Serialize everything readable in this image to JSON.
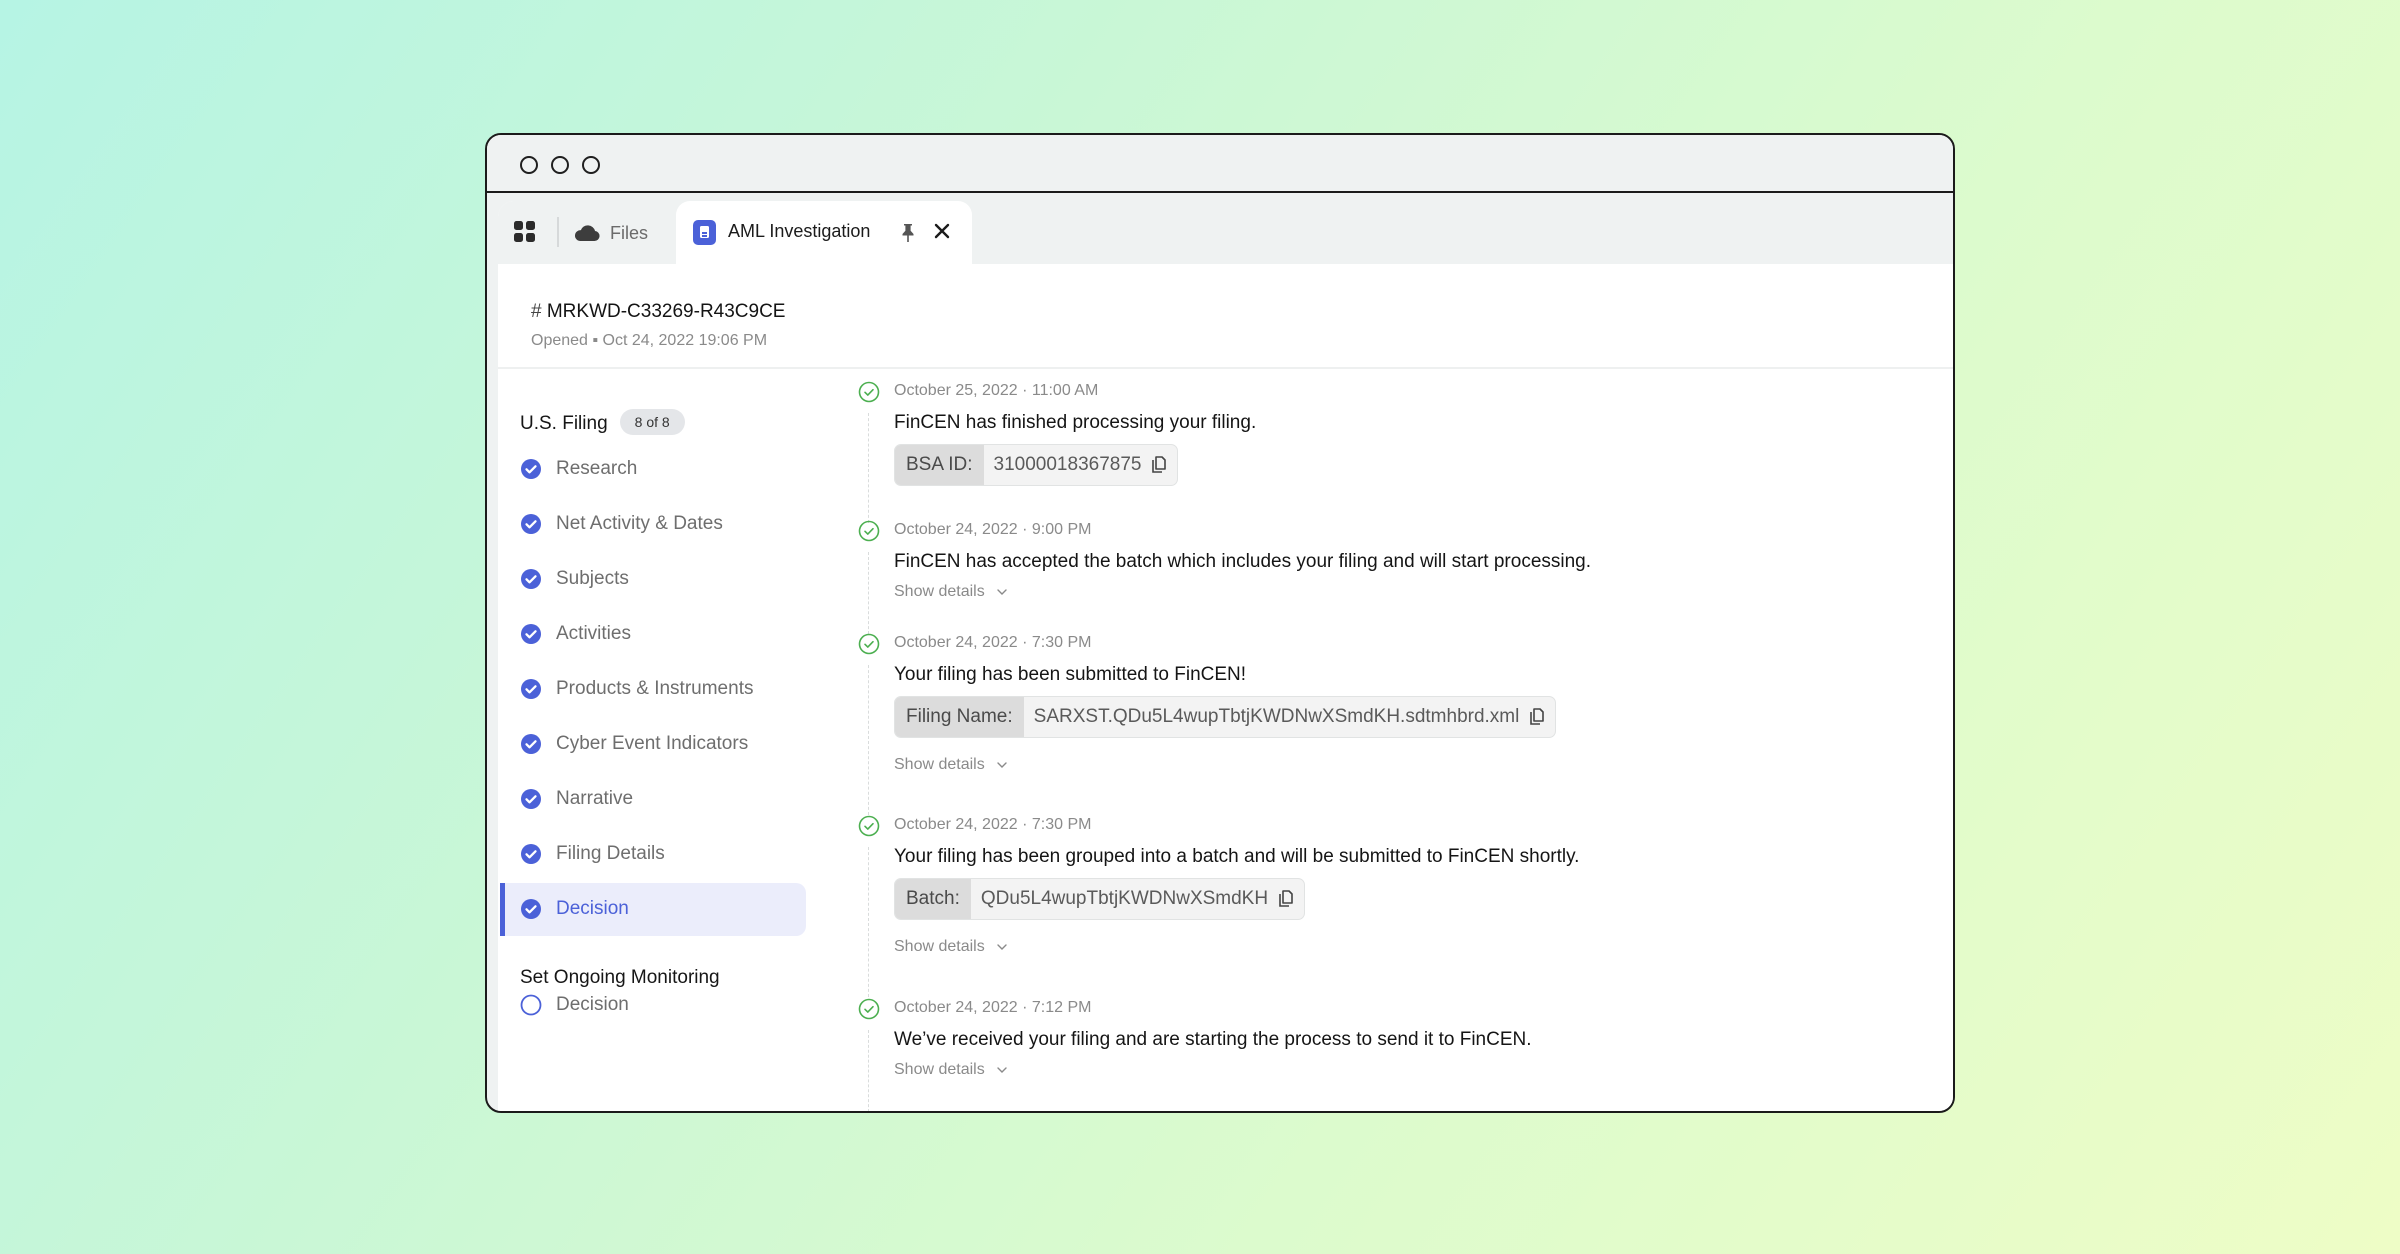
{
  "window": {
    "traffic_lights": [
      "close",
      "minimize",
      "maximize"
    ]
  },
  "tabs": {
    "apps_icon": "grid-icon",
    "files": {
      "icon": "cloud-icon",
      "label": "Files"
    },
    "active": {
      "icon": "document-icon",
      "label": "AML Investigation",
      "pin_icon": "pin-icon",
      "close_icon": "close-icon"
    }
  },
  "header": {
    "hash": "#",
    "case_id": "MRKWD-C33269-R43C9CE",
    "opened": "Opened ▪ Oct 24, 2022 19:06 PM"
  },
  "sidebar": {
    "sections": [
      {
        "title": "U.S. Filing",
        "badge": "8 of 8",
        "items": [
          {
            "label": "Research",
            "status": "complete",
            "active": false
          },
          {
            "label": "Net Activity & Dates",
            "status": "complete",
            "active": false
          },
          {
            "label": "Subjects",
            "status": "complete",
            "active": false
          },
          {
            "label": "Activities",
            "status": "complete",
            "active": false
          },
          {
            "label": "Products & Instruments",
            "status": "complete",
            "active": false
          },
          {
            "label": "Cyber Event Indicators",
            "status": "complete",
            "active": false
          },
          {
            "label": "Narrative",
            "status": "complete",
            "active": false
          },
          {
            "label": "Filing Details",
            "status": "complete",
            "active": false
          },
          {
            "label": "Decision",
            "status": "complete",
            "active": true
          }
        ]
      },
      {
        "title": "Set Ongoing Monitoring",
        "items": [
          {
            "label": "Decision",
            "status": "pending",
            "active": false
          }
        ]
      }
    ]
  },
  "timeline": {
    "show_details_label": "Show details",
    "entries": [
      {
        "date": "October 25, 2022 · 11:00 AM",
        "message": "FinCEN has finished processing your filing.",
        "chip": {
          "key": "BSA ID:",
          "value": "31000018367875"
        },
        "show_details": false
      },
      {
        "date": "October 24, 2022 · 9:00 PM",
        "message": "FinCEN has accepted the batch which includes your filing and will start processing.",
        "show_details": true
      },
      {
        "date": "October 24, 2022 · 7:30 PM",
        "message": "Your filing has been submitted to FinCEN!",
        "chip": {
          "key": "Filing Name:",
          "value": "SARXST.QDu5L4wupTbtjKWDNwXSmdKH.sdtmhbrd.xml"
        },
        "show_details": true
      },
      {
        "date": "October 24, 2022 · 7:30 PM",
        "message": "Your filing has been grouped into a batch and will be submitted to FinCEN shortly.",
        "chip": {
          "key": "Batch:",
          "value": "QDu5L4wupTbtjKWDNwXSmdKH"
        },
        "show_details": true
      },
      {
        "date": "October 24, 2022 · 7:12 PM",
        "message": "We’ve received your filing and are starting the process to send it to FinCEN.",
        "show_details": true
      }
    ]
  },
  "colors": {
    "accent": "#4b61d8",
    "success": "#4caf50",
    "active_bg": "#ebedfb"
  }
}
